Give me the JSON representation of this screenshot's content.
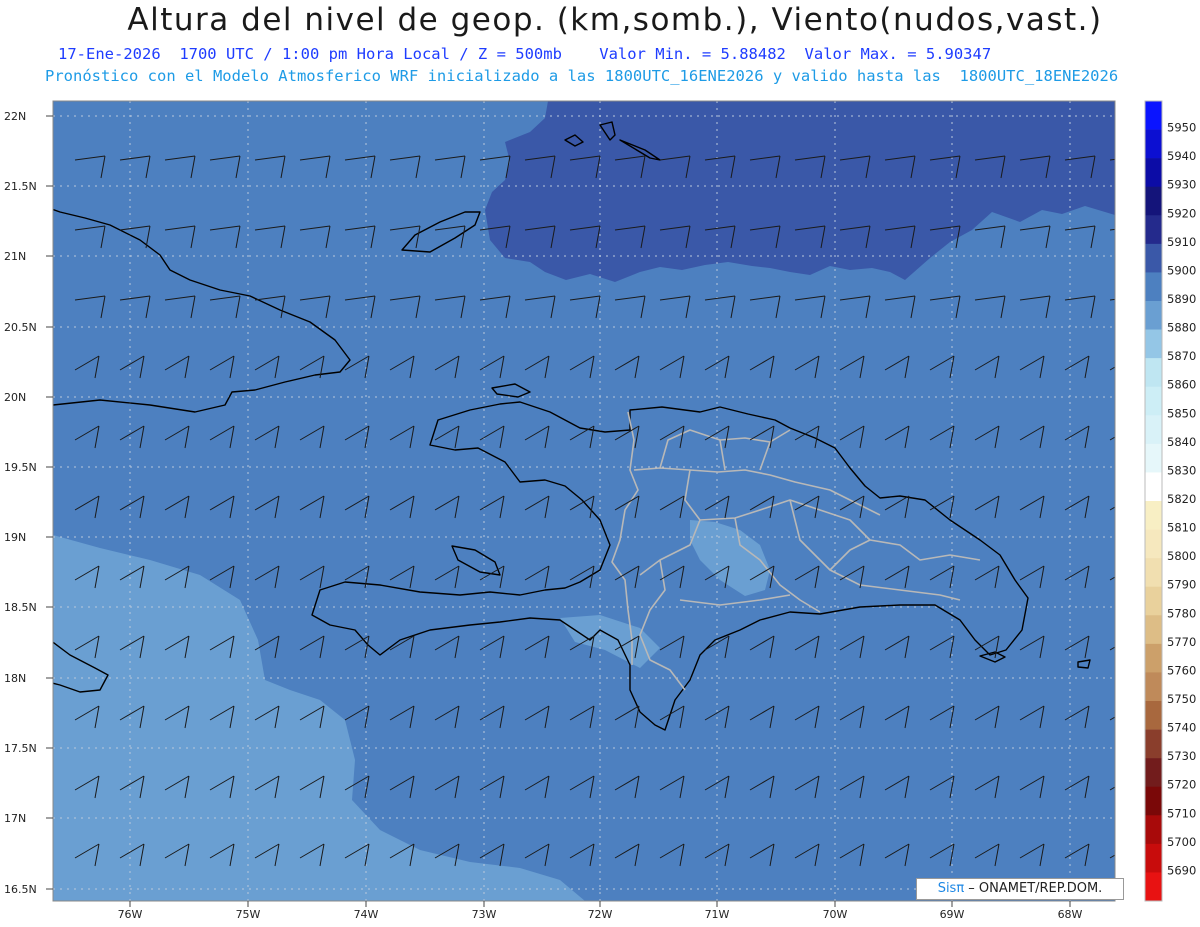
{
  "header": {
    "title": "Altura del nivel de geop. (km,somb.), Viento(nudos,vast.)",
    "line1": "17-Ene-2026  1700 UTC / 1:00 pm Hora Local / Z = 500mb    Valor Min. = 5.88482  Valor Max. = 5.90347",
    "line2": "Pronóstico con el Modelo Atmosferico WRF inicializado a las 1800UTC_16ENE2026 y valido hasta las  1800UTC_18ENE2026"
  },
  "map": {
    "lat_labels": [
      "22N",
      "21.5N",
      "21N",
      "20.5N",
      "20N",
      "19.5N",
      "19N",
      "18.5N",
      "18N",
      "17.5N",
      "17N",
      "16.5N"
    ],
    "lon_labels": [
      "76W",
      "75W",
      "74W",
      "73W",
      "72W",
      "71W",
      "70W",
      "69W",
      "68W"
    ],
    "lat_range": [
      16.5,
      22.0
    ],
    "lon_range": [
      -76.65,
      -67.6
    ],
    "grid": "dotted",
    "shading_colors": {
      "5880": "#6a9fd2",
      "5890": "#4d80c0",
      "5900": "#3a58a8"
    }
  },
  "colorbar": {
    "labels": [
      "5950",
      "5940",
      "5930",
      "5920",
      "5910",
      "5900",
      "5890",
      "5880",
      "5870",
      "5860",
      "5850",
      "5840",
      "5830",
      "5820",
      "5810",
      "5800",
      "5790",
      "5780",
      "5770",
      "5760",
      "5750",
      "5740",
      "5730",
      "5720",
      "5710",
      "5700",
      "5690"
    ],
    "colors": [
      "#0a14ff",
      "#0c0fd2",
      "#0c0ca6",
      "#14147a",
      "#242a8c",
      "#3a58a8",
      "#4d80c0",
      "#6a9fd2",
      "#94c6e6",
      "#bfe6f2",
      "#cdeef6",
      "#d9f2f8",
      "#e6f7fa",
      "#ffffff",
      "#f8efc4",
      "#f6e8be",
      "#f1dfb0",
      "#e9d19c",
      "#ddbd86",
      "#cca06a",
      "#bf8a5a",
      "#a8683e",
      "#8a3e2c",
      "#721c1c",
      "#7a0808",
      "#a80a0a",
      "#c80c0c",
      "#e81212"
    ]
  },
  "credit": {
    "brand": "Sisπ",
    "text": " – ONAMET/REP.DOM."
  }
}
